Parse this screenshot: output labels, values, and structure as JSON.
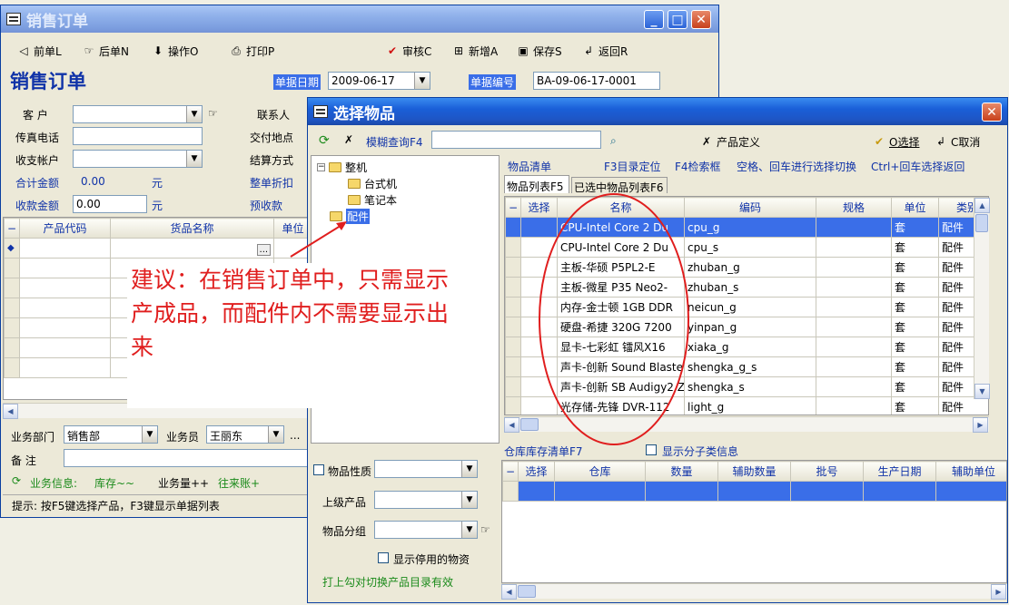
{
  "main_window": {
    "title": "销售订单",
    "toolbar": {
      "prev": "前单L",
      "next": "后单N",
      "operate": "操作O",
      "print": "打印P",
      "audit": "审核C",
      "add": "新增A",
      "save": "保存S",
      "back": "返回R"
    },
    "heading": "销售订单",
    "doc_date_label": "单据日期",
    "doc_date": "2009-06-17",
    "doc_no_label": "单据编号",
    "doc_no": "BA-09-06-17-0001",
    "form": {
      "customer": "客 户",
      "contact": "联系人",
      "fax": "传真电话",
      "delivery_place": "交付地点",
      "account": "收支帐户",
      "settle_method": "结算方式",
      "total_label": "合计金额",
      "total_value": "0.00",
      "unit": "元",
      "discount": "整单折扣",
      "received_label": "收款金额",
      "received_value": "0.00",
      "unit2": "元",
      "prepaid": "预收款"
    },
    "grid_headers": [
      "产品代码",
      "货品名称",
      "单位"
    ],
    "dept_label": "业务部门",
    "dept_value": "销售部",
    "staff_label": "业务员",
    "staff_value": "王丽东",
    "remark_label": "备 注",
    "info": {
      "business": "业务信息:",
      "stock": "库存~~",
      "volume": "业务量++",
      "account": "往来账+"
    },
    "hint": "提示: 按F5键选择产品，F3键显示单据列表"
  },
  "dialog": {
    "title": "选择物品",
    "fuzzy_query": "模糊查询F4",
    "product_def": "产品定义",
    "select": "O选择",
    "cancel": "C取消",
    "tree": {
      "root": "整机",
      "child1": "台式机",
      "child2": "笔记本",
      "root2": "配件"
    },
    "menu": [
      "物品清单",
      "F3目录定位",
      "F4检索框",
      "空格、回车进行选择切换",
      "Ctrl+回车选择返回"
    ],
    "tabs": [
      "物品列表F5",
      "已选中物品列表F6"
    ],
    "columns": [
      "选择",
      "名称",
      "编码",
      "规格",
      "单位",
      "类别"
    ],
    "rows": [
      {
        "name": "CPU-Intel Core 2 Du",
        "code": "cpu_g",
        "unit": "套",
        "cat": "配件"
      },
      {
        "name": "CPU-Intel Core 2 Du",
        "code": "cpu_s",
        "unit": "套",
        "cat": "配件"
      },
      {
        "name": "主板-华硕 P5PL2-E",
        "code": "zhuban_g",
        "unit": "套",
        "cat": "配件"
      },
      {
        "name": "主板-微星 P35 Neo2-",
        "code": "zhuban_s",
        "unit": "套",
        "cat": "配件"
      },
      {
        "name": "内存-金士顿 1GB DDR",
        "code": "neicun_g",
        "unit": "套",
        "cat": "配件"
      },
      {
        "name": "硬盘-希捷 320G 7200",
        "code": "yinpan_g",
        "unit": "套",
        "cat": "配件"
      },
      {
        "name": "显卡-七彩虹 镭风X16",
        "code": "xiaka_g",
        "unit": "套",
        "cat": "配件"
      },
      {
        "name": "声卡-创新 Sound Blaste",
        "code": "shengka_g_s",
        "unit": "套",
        "cat": "配件"
      },
      {
        "name": "声卡-创新 SB Audigy2 Z",
        "code": "shengka_s",
        "unit": "套",
        "cat": "配件"
      },
      {
        "name": "光存储-先锋 DVR-112",
        "code": "light_g",
        "unit": "套",
        "cat": "配件"
      }
    ],
    "stock_title": "仓库库存清单F7",
    "show_sub": "显示分子类信息",
    "stock_columns": [
      "选择",
      "仓库",
      "数量",
      "辅助数量",
      "批号",
      "生产日期",
      "辅助单位"
    ],
    "props": {
      "nature": "物品性质",
      "parent": "上级产品",
      "group": "物品分组",
      "show_disabled": "显示停用的物资"
    },
    "footer": "打上勾对切换产品目录有效"
  },
  "annotation": "建议：在销售订单中，只需显示产成品，而配件内不需要显示出来",
  "colors": {
    "annotation": "#e01e1e",
    "circle": "#e01e1e",
    "selected_row": "#3a6ee8"
  }
}
